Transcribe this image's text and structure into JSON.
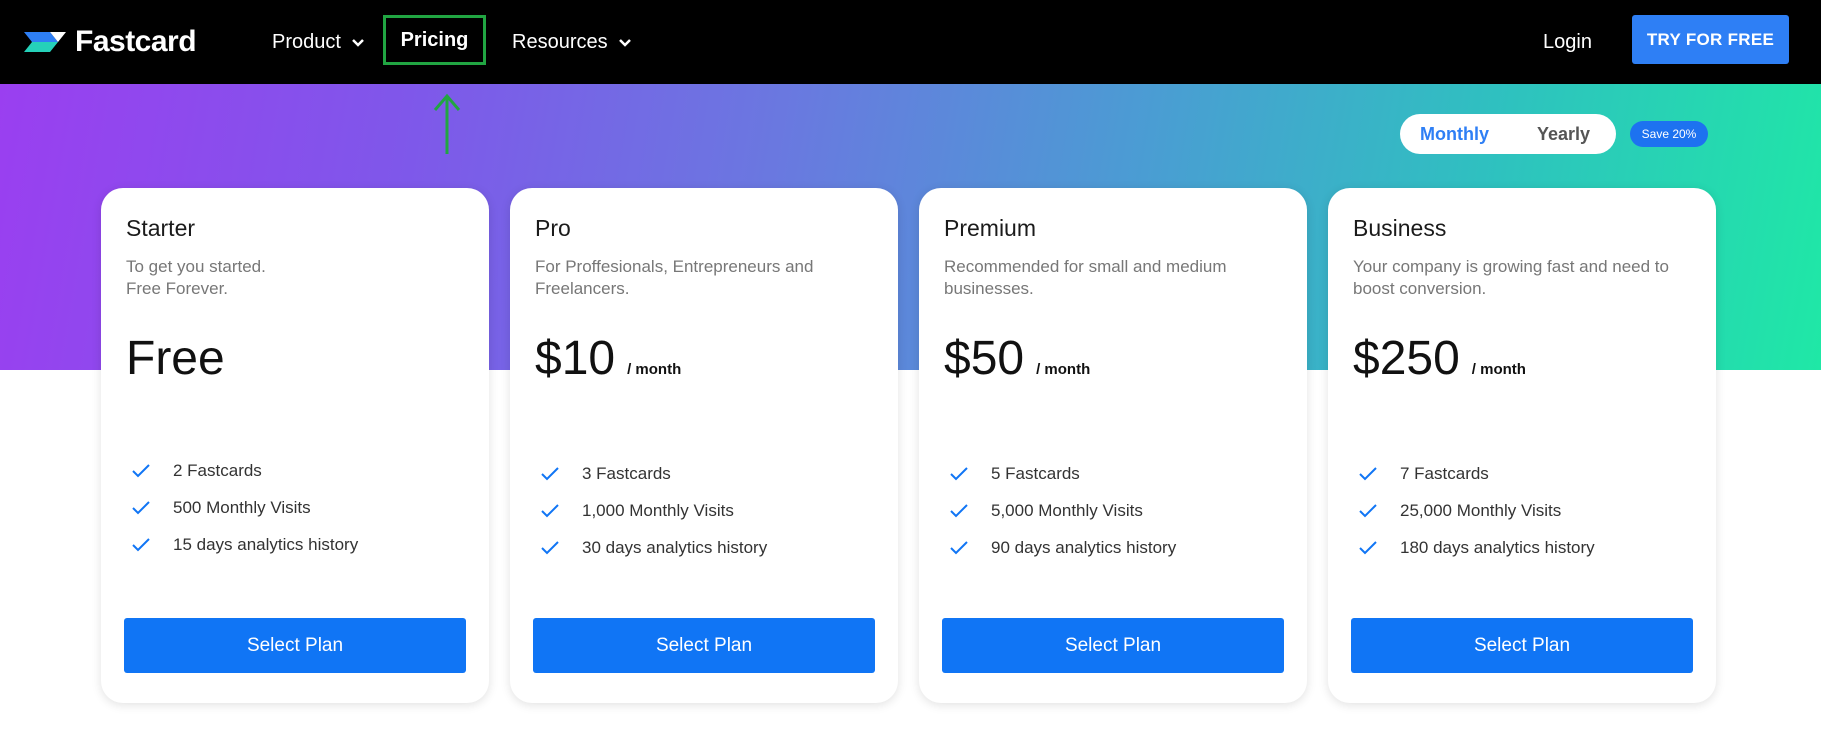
{
  "nav": {
    "brand": "Fastcard",
    "items": [
      {
        "label": "Product",
        "has_dropdown": true
      },
      {
        "label": "Pricing",
        "has_dropdown": false,
        "highlighted": true
      },
      {
        "label": "Resources",
        "has_dropdown": true
      }
    ],
    "login": "Login",
    "cta": "TRY FOR FREE"
  },
  "billing_toggle": {
    "options": [
      "Monthly",
      "Yearly"
    ],
    "selected": "Monthly",
    "badge": "Save 20%"
  },
  "plans": [
    {
      "name": "Starter",
      "description": "To get you started.\nFree Forever.",
      "price": "Free",
      "unit": "",
      "features": [
        "2 Fastcards",
        "500 Monthly Visits",
        "15 days analytics history"
      ],
      "button": "Select Plan"
    },
    {
      "name": "Pro",
      "description": "For Proffesionals, Entrepreneurs and Freelancers.",
      "price": "$10",
      "unit": "/ month",
      "features": [
        "3 Fastcards",
        "1,000 Monthly Visits",
        "30 days analytics history"
      ],
      "button": "Select Plan"
    },
    {
      "name": "Premium",
      "description": "Recommended for small and medium businesses.",
      "price": "$50",
      "unit": "/ month",
      "features": [
        "5 Fastcards",
        "5,000 Monthly Visits",
        "90 days analytics history"
      ],
      "button": "Select Plan"
    },
    {
      "name": "Business",
      "description": "Your company is growing fast and need to boost conversion.",
      "price": "$250",
      "unit": "/ month",
      "features": [
        "7 Fastcards",
        "25,000 Monthly Visits",
        "180 days analytics history"
      ],
      "button": "Select Plan"
    }
  ],
  "icons": {
    "logo": "fastcard-logo-icon",
    "dropdown": "chevron-down-icon",
    "feature": "checkmark-icon",
    "annotation": "arrow-up-icon"
  },
  "colors": {
    "primary": "#1075f5",
    "annotation": "#21a542",
    "navbar": "#000000"
  }
}
